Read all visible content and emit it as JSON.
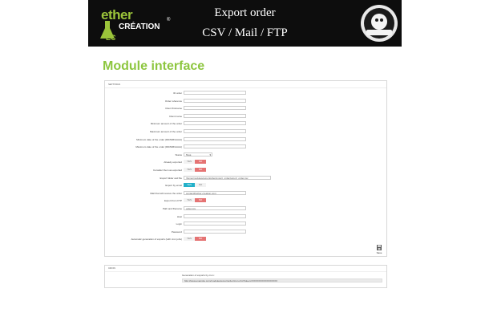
{
  "banner": {
    "logo_ether": "ether",
    "logo_creation": "CRÉATION",
    "logo_ec": "EC",
    "logo_registered": "®",
    "title_line1": "Export order",
    "title_line2": "CSV / Mail / FTP",
    "badge_text": "PRESTASHOP PARTNER PLATINUM",
    "accent_color": "#9bc43a"
  },
  "section_title": "Module interface",
  "form": {
    "header": "SETTINGS",
    "fields": [
      {
        "label": "ID order",
        "type": "input",
        "value": ""
      },
      {
        "label": "Order reference",
        "type": "input",
        "value": ""
      },
      {
        "label": "Client firstname",
        "type": "input",
        "value": ""
      },
      {
        "label": "Client name",
        "type": "input",
        "value": ""
      },
      {
        "label": "Minimum amount of the order",
        "type": "input",
        "value": ""
      },
      {
        "label": "Maximum amount of the order",
        "type": "input",
        "value": ""
      },
      {
        "label": "Minimum date of the order (DD/MM/AAAA)",
        "type": "input",
        "value": ""
      },
      {
        "label": "Maximum date of the order (DD/MM/AAAA)",
        "type": "input",
        "value": ""
      },
      {
        "label": "Status",
        "type": "select",
        "value": "Tous"
      },
      {
        "label": "Already exported",
        "type": "switch",
        "yes": "YES",
        "no": "NO",
        "state": "no"
      },
      {
        "label": "Consider them as exported",
        "type": "switch",
        "yes": "YES",
        "no": "NO",
        "state": "no"
      },
      {
        "label": "Export folder and file",
        "type": "input-long",
        "value": "/home/modules/exportorder/export_order/export_order.csv"
      },
      {
        "label": "Export by email",
        "type": "switch",
        "yes": "YES",
        "no": "NO",
        "state": "yes"
      },
      {
        "label": "Mail that will receive the order",
        "type": "input",
        "value": "contact@ether-creation.com"
      },
      {
        "label": "Export from FTP",
        "type": "switch",
        "yes": "YES",
        "no": "NO",
        "state": "no"
      },
      {
        "label": "Path and filename",
        "type": "input",
        "value": "order.csv"
      },
      {
        "label": "Host",
        "type": "input",
        "value": ""
      },
      {
        "label": "Login",
        "type": "input",
        "value": ""
      },
      {
        "label": "Password",
        "type": "input",
        "value": ""
      },
      {
        "label": "Automatic generation of exports (with cron jobs)",
        "type": "switch",
        "yes": "YES",
        "no": "NO",
        "state": "no"
      }
    ],
    "save_label": "Save"
  },
  "cron": {
    "header": "CRON",
    "label": "Generation of exports by cron :",
    "url": "http://www.example.com/modules/exportorder/cron.php?token=XXXXXXXXXXXXXXXX"
  }
}
